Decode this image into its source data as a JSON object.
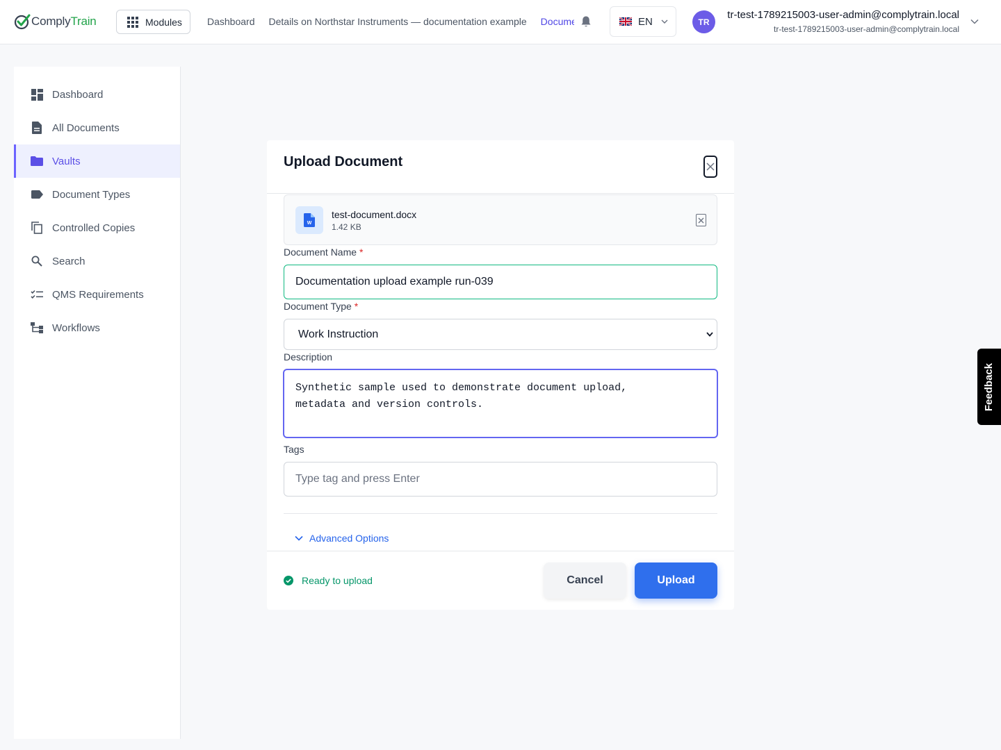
{
  "app": {
    "logo_part1": "Comply",
    "logo_part2": "Train",
    "modules_label": "Modules"
  },
  "breadcrumbs": [
    "Dashboard",
    "Details on Northstar Instruments — documentation example",
    "Documents"
  ],
  "language": {
    "label": "EN",
    "flag_icon": "uk-flag-icon"
  },
  "user": {
    "initials": "TR",
    "name": "tr-test-1789215003-user-admin@complytrain.local",
    "email": "tr-test-1789215003-user-admin@complytrain.local"
  },
  "sidebar": {
    "items": [
      {
        "label": "Dashboard",
        "icon": "dashboard-icon",
        "active": false
      },
      {
        "label": "All Documents",
        "icon": "document-icon",
        "active": false
      },
      {
        "label": "Vaults",
        "icon": "folder-icon",
        "active": true
      },
      {
        "label": "Document Types",
        "icon": "tag-icon",
        "active": false
      },
      {
        "label": "Controlled Copies",
        "icon": "copy-icon",
        "active": false
      },
      {
        "label": "Search",
        "icon": "search-icon",
        "active": false
      },
      {
        "label": "QMS Requirements",
        "icon": "checklist-icon",
        "active": false
      },
      {
        "label": "Workflows",
        "icon": "workflow-icon",
        "active": false
      }
    ]
  },
  "modal": {
    "title": "Upload Document",
    "file": {
      "name": "test-document.docx",
      "size": "1.42 KB"
    },
    "document_name": {
      "label": "Document Name",
      "required_mark": "*",
      "value": "Documentation upload example run-039"
    },
    "document_type": {
      "label": "Document Type",
      "required_mark": "*",
      "selected": "Work Instruction"
    },
    "description": {
      "label": "Description",
      "value": "Synthetic sample used to demonstrate document upload,\nmetadata and version controls."
    },
    "tags": {
      "label": "Tags",
      "placeholder": "Type tag and press Enter"
    },
    "advanced_label": "Advanced Options",
    "status": "Ready to upload",
    "cancel_label": "Cancel",
    "upload_label": "Upload"
  },
  "feedback_label": "Feedback",
  "colors": {
    "accent": "#6c63ff",
    "primary_button": "#2f6fed",
    "success": "#059669",
    "brand_green": "#22a34a"
  }
}
